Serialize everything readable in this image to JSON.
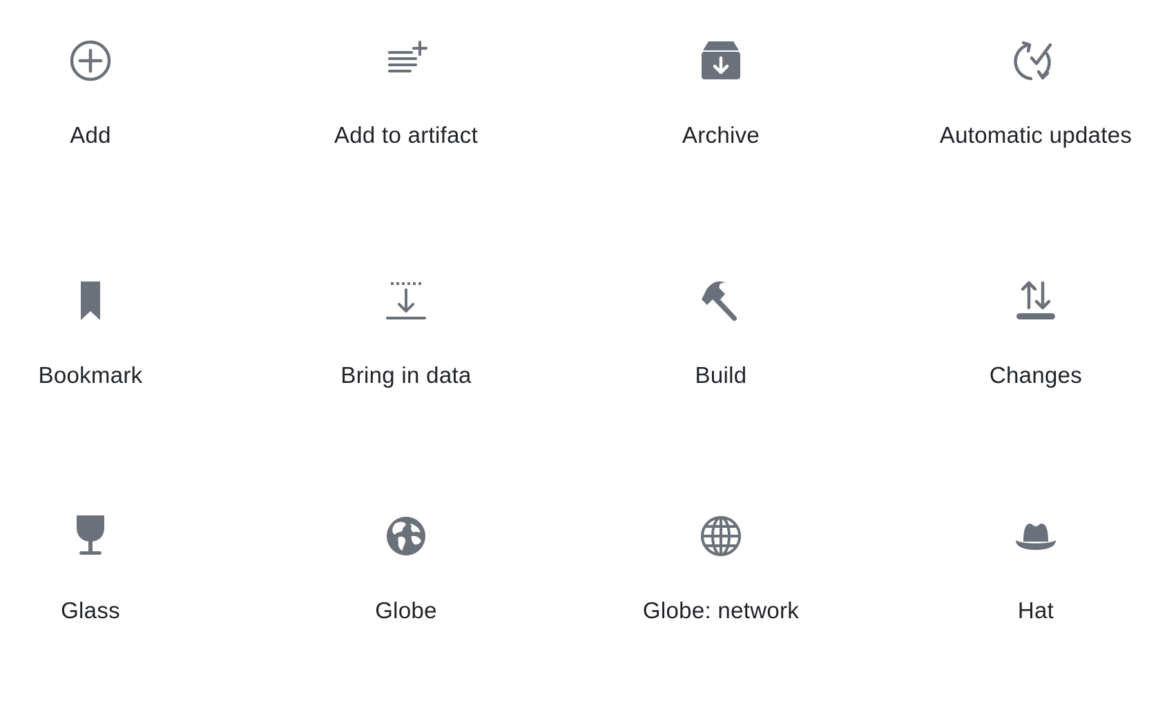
{
  "theme": {
    "icon_color": "#6b717a",
    "text_color": "#1f2328",
    "background": "#ffffff"
  },
  "icons": [
    {
      "label": "Add",
      "icon": "plus-circle-icon"
    },
    {
      "label": "Add to artifact",
      "icon": "list-add-icon"
    },
    {
      "label": "Archive",
      "icon": "archive-box-icon"
    },
    {
      "label": "Automatic updates",
      "icon": "sync-check-icon"
    },
    {
      "label": "Bookmark",
      "icon": "bookmark-icon"
    },
    {
      "label": "Bring in data",
      "icon": "import-arrow-icon"
    },
    {
      "label": "Build",
      "icon": "hammer-icon"
    },
    {
      "label": "Changes",
      "icon": "up-down-arrows-icon"
    },
    {
      "label": "Glass",
      "icon": "wine-glass-icon"
    },
    {
      "label": "Globe",
      "icon": "earth-globe-icon"
    },
    {
      "label": "Globe: network",
      "icon": "network-globe-icon"
    },
    {
      "label": "Hat",
      "icon": "hat-icon"
    }
  ]
}
